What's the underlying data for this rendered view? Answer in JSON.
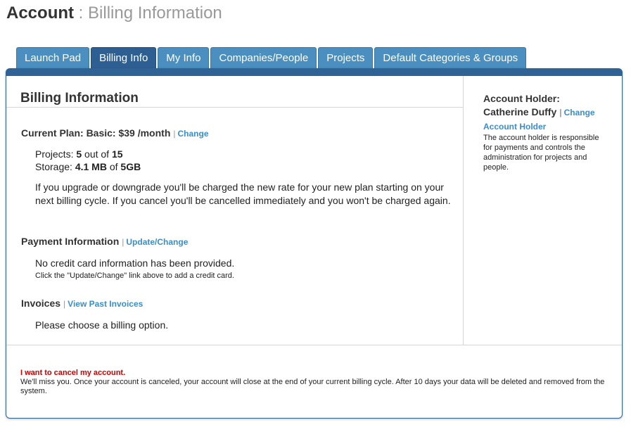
{
  "header": {
    "title_main": "Account",
    "title_sep": " : ",
    "title_sub": "Billing Information"
  },
  "tabs": [
    {
      "label": "Launch Pad"
    },
    {
      "label": "Billing Info"
    },
    {
      "label": "My Info"
    },
    {
      "label": "Companies/People"
    },
    {
      "label": "Projects"
    },
    {
      "label": "Default Categories & Groups"
    }
  ],
  "active_tab": "Billing Info",
  "billing": {
    "section_title": "Billing Information",
    "pipe": "|",
    "plan": {
      "label": "Current Plan: Basic: $39 /month",
      "change_link": "Change"
    },
    "projects": {
      "prefix": "Projects: ",
      "used": "5",
      "mid": " out of ",
      "total": "15"
    },
    "storage": {
      "prefix": "Storage: ",
      "used": "4.1 MB",
      "mid": " of ",
      "total": "5GB"
    },
    "plan_note": "If you upgrade or downgrade you'll be charged the new rate for your new plan starting on your next billing cycle. If you cancel you'll be cancelled immediately and you won't be charged again.",
    "payment": {
      "label": "Payment Information",
      "link": "Update/Change",
      "status": "No credit card information has been provided.",
      "hint": "Click the \"Update/Change\" link above to add a credit card."
    },
    "invoices": {
      "label": "Invoices",
      "link": "View Past Invoices",
      "message": "Please choose a billing option."
    }
  },
  "sidebar": {
    "holder_label": "Account Holder:",
    "holder_name": "Catherine Duffy",
    "change_link": "Change",
    "holder_link": "Account Holder",
    "holder_desc": "The account holder is responsible for payments and controls the administration for projects and people."
  },
  "cancel": {
    "link": "I want to cancel my account.",
    "text": "We'll miss you. Once your account is canceled, your account will close at the end of your current billing cycle. After 10 days your data will be deleted and removed from the system."
  },
  "colors": {
    "tab": "#4a8fbf",
    "tab_active": "#2e5f93",
    "link": "#3a8dd0",
    "cancel": "#cc0000"
  }
}
